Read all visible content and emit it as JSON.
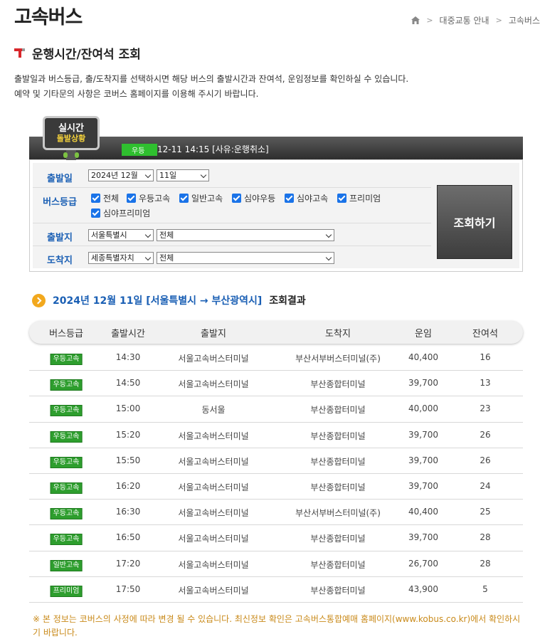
{
  "page_title": "고속버스",
  "breadcrumb": [
    "대중교통 안내",
    "고속버스"
  ],
  "section_title": "운행시간/잔여석 조회",
  "description": [
    "출발일과 버스등급, 출/도착지를 선택하시면 해당 버스의 출발시간과 잔여석, 운임정보를 확인하실 수 있습니다.",
    "예약 및 기타문의 사항은 코버스 홈페이지를 이용해 주시기 바랍니다."
  ],
  "realtime": {
    "badge_line1": "실시간",
    "badge_line2": "돌발상황",
    "tag": "우등",
    "message": "12-11 14:15 [사유:운행취소]"
  },
  "form": {
    "date_label": "출발일",
    "year_month": "2024년 12월",
    "day": "11일",
    "grade_label": "버스등급",
    "grades": [
      "전체",
      "우등고속",
      "일반고속",
      "심야우등",
      "심야고속",
      "프리미엄",
      "심야프리미엄"
    ],
    "origin_label": "출발지",
    "origin_region": "서울특별시",
    "origin_terminal": "전체",
    "dest_label": "도착지",
    "dest_region": "세종특별자치",
    "dest_terminal": "전체",
    "search_button": "조회하기"
  },
  "result": {
    "title_blue": "2024년 12월 11일 [서울특별시 → 부산광역시]",
    "title_suffix": "조회결과",
    "columns": [
      "버스등급",
      "출발시간",
      "출발지",
      "도착지",
      "운임",
      "잔여석"
    ],
    "rows": [
      {
        "grade": "우등고속",
        "time": "14:30",
        "from": "서울고속버스터미널",
        "to": "부산서부버스터미널(주)",
        "fare": "40,400",
        "seats": "16"
      },
      {
        "grade": "우등고속",
        "time": "14:50",
        "from": "서울고속버스터미널",
        "to": "부산종합터미널",
        "fare": "39,700",
        "seats": "13"
      },
      {
        "grade": "우등고속",
        "time": "15:00",
        "from": "동서울",
        "to": "부산종합터미널",
        "fare": "40,000",
        "seats": "23"
      },
      {
        "grade": "우등고속",
        "time": "15:20",
        "from": "서울고속버스터미널",
        "to": "부산종합터미널",
        "fare": "39,700",
        "seats": "26"
      },
      {
        "grade": "우등고속",
        "time": "15:50",
        "from": "서울고속버스터미널",
        "to": "부산종합터미널",
        "fare": "39,700",
        "seats": "26"
      },
      {
        "grade": "우등고속",
        "time": "16:20",
        "from": "서울고속버스터미널",
        "to": "부산종합터미널",
        "fare": "39,700",
        "seats": "24"
      },
      {
        "grade": "우등고속",
        "time": "16:30",
        "from": "서울고속버스터미널",
        "to": "부산서부버스터미널(주)",
        "fare": "40,400",
        "seats": "25"
      },
      {
        "grade": "우등고속",
        "time": "16:50",
        "from": "서울고속버스터미널",
        "to": "부산종합터미널",
        "fare": "39,700",
        "seats": "28"
      },
      {
        "grade": "일반고속",
        "time": "17:20",
        "from": "서울고속버스터미널",
        "to": "부산종합터미널",
        "fare": "26,700",
        "seats": "28"
      },
      {
        "grade": "프리미엄",
        "time": "17:50",
        "from": "서울고속버스터미널",
        "to": "부산종합터미널",
        "fare": "43,900",
        "seats": "5"
      }
    ]
  },
  "footnote": "※ 본 정보는 코버스의 사정에 따라 변경 될 수 있습니다. 최신정보 확인은 고속버스통합예매 홈페이지(www.kobus.co.kr)에서 확인하시기 바랍니다.",
  "colors": {
    "accent_blue": "#1a5fb4",
    "grade_green": "#2e9e2e",
    "notice_orange": "#c98a1a",
    "realtime_green": "#2fbf2f"
  },
  "icons": {
    "home": "home-icon",
    "section": "section-mark-icon",
    "result": "chevron-circle-icon"
  }
}
